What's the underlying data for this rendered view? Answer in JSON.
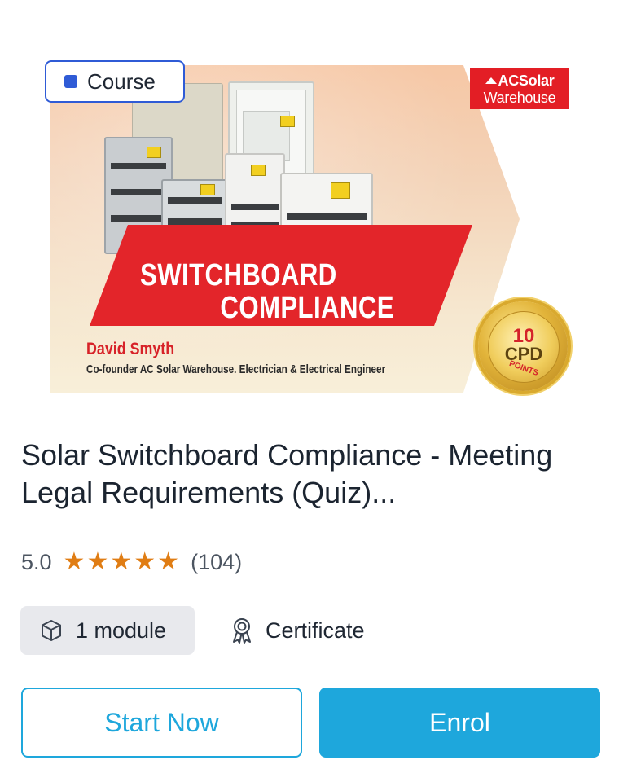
{
  "banner": {
    "tag_label": "Course",
    "brand_line1": "ACSolar",
    "brand_line2": "Warehouse",
    "headline_line1": "SWITCHBOARD",
    "headline_line2": "COMPLIANCE",
    "author_name": "David Smyth",
    "author_role": "Co-founder AC Solar Warehouse. Electrician & Electrical Engineer",
    "seal_number": "10",
    "seal_text": "CPD",
    "seal_sub": "POINTS"
  },
  "course": {
    "title": "Solar Switchboard Compliance - Meeting Legal Requirements (Quiz)...",
    "rating_score": "5.0",
    "rating_stars": 5,
    "rating_count": "(104)",
    "modules_label": "1 module",
    "certificate_label": "Certificate"
  },
  "actions": {
    "start_label": "Start Now",
    "enrol_label": "Enrol"
  },
  "colors": {
    "accent": "#1ea7dc",
    "tag_blue": "#2f5bd6",
    "star": "#e07d14",
    "brand_red": "#e31e25"
  }
}
